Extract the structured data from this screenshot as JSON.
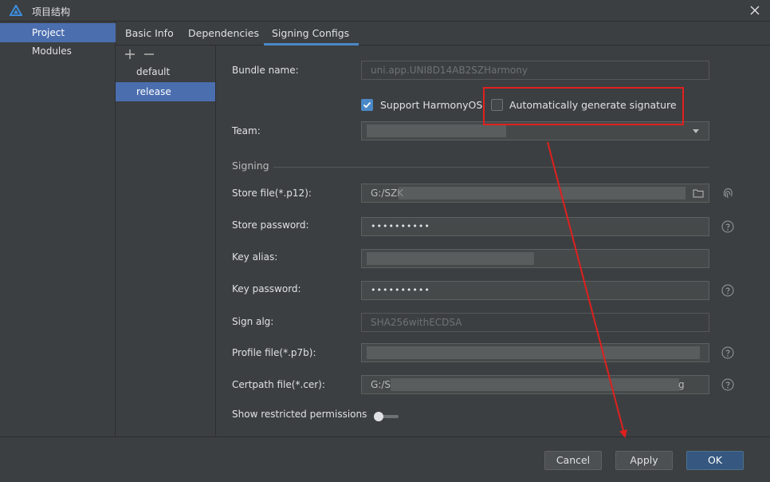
{
  "window": {
    "title": "项目结构"
  },
  "nav": {
    "items": [
      {
        "label": "Project"
      },
      {
        "label": "Modules"
      }
    ]
  },
  "tabs": [
    {
      "label": "Basic Info"
    },
    {
      "label": "Dependencies"
    },
    {
      "label": "Signing Configs"
    }
  ],
  "configs": {
    "add_icon": "plus-icon",
    "remove_icon": "minus-icon",
    "items": [
      {
        "label": "default"
      },
      {
        "label": "release"
      }
    ]
  },
  "form": {
    "bundle_name": {
      "label": "Bundle name:",
      "value": "uni.app.UNI8D14AB2SZHarmony"
    },
    "support_harmony": {
      "label": "Support HarmonyOS",
      "checked": true
    },
    "auto_sign": {
      "label": "Automatically generate signature",
      "checked": false
    },
    "team": {
      "label": "Team:"
    },
    "signing_section": "Signing",
    "store_file": {
      "label": "Store file(*.p12):",
      "value": "G:/SZK"
    },
    "store_password": {
      "label": "Store password:",
      "value": "••••••••••"
    },
    "key_alias": {
      "label": "Key alias:"
    },
    "key_password": {
      "label": "Key password:",
      "value": "••••••••••"
    },
    "sign_alg": {
      "label": "Sign alg:",
      "value": "SHA256withECDSA"
    },
    "profile_file": {
      "label": "Profile file(*.p7b):"
    },
    "certpath_file": {
      "label": "Certpath file(*.cer):",
      "value": "G:/S",
      "value_end": "g"
    },
    "restricted": {
      "label": "Show restricted permissions",
      "on": false
    }
  },
  "buttons": {
    "cancel": "Cancel",
    "apply": "Apply",
    "ok": "OK"
  },
  "colors": {
    "accent": "#4a88c7",
    "selection": "#4b6eaf",
    "annotation": "#e0201e"
  }
}
